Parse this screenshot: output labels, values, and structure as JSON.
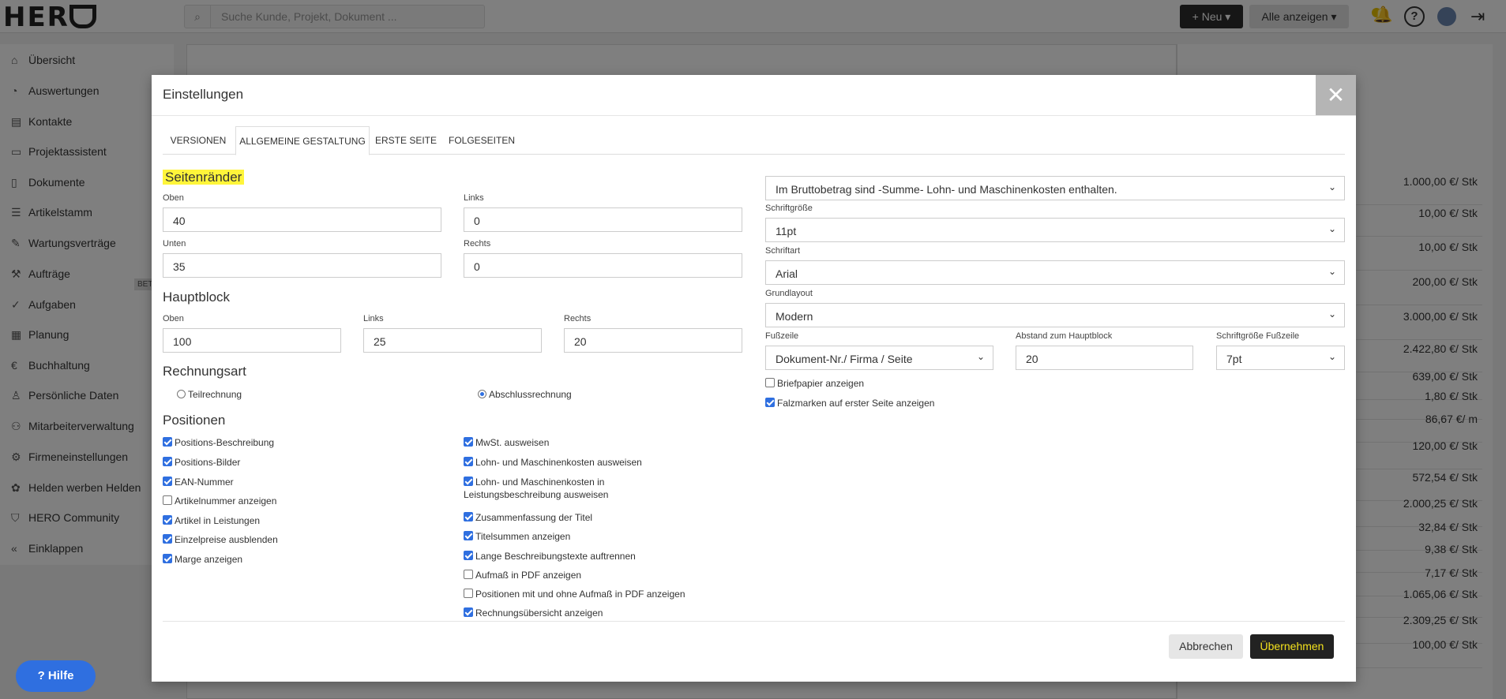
{
  "app": {
    "search_placeholder": "Suche Kunde, Projekt, Dokument ...",
    "new_label": "+ Neu",
    "filter_label": "Alle anzeigen",
    "help_icon_text": "?",
    "hilfe_label": "Hilfe"
  },
  "sidebar": {
    "items": [
      {
        "label": "Übersicht",
        "icon": "home-icon"
      },
      {
        "label": "Auswertungen",
        "icon": "pie-chart-icon"
      },
      {
        "label": "Kontakte",
        "icon": "contacts-icon"
      },
      {
        "label": "Projektassistent",
        "icon": "inbox-icon"
      },
      {
        "label": "Dokumente",
        "icon": "document-icon"
      },
      {
        "label": "Artikelstamm",
        "icon": "list-icon"
      },
      {
        "label": "Wartungsverträge",
        "icon": "wrench-icon"
      },
      {
        "label": "Aufträge",
        "icon": "hammer-icon"
      },
      {
        "label": "Aufgaben",
        "icon": "check-circle-icon"
      },
      {
        "label": "Planung",
        "icon": "calendar-icon"
      },
      {
        "label": "Buchhaltung",
        "icon": "euro-icon"
      },
      {
        "label": "Persönliche Daten",
        "icon": "user-icon"
      },
      {
        "label": "Mitarbeiterverwaltung",
        "icon": "users-icon"
      },
      {
        "label": "Firmeneinstellungen",
        "icon": "gear-icon"
      },
      {
        "label": "Helden werben Helden",
        "icon": "gift-icon"
      },
      {
        "label": "HERO Community",
        "icon": "hero-icon"
      },
      {
        "label": "Einklappen",
        "icon": "collapse-icon"
      }
    ],
    "beta_badge": "BET"
  },
  "right_panel": {
    "prices": [
      "1.000,00 €/ Stk",
      "10,00 €/ Stk",
      "10,00 €/ Stk",
      "200,00 €/ Stk",
      "3.000,00 €/ Stk",
      "2.422,80 €/ Stk",
      "639,00 €/ Stk",
      "1,80 €/ Stk",
      "86,67 €/ m",
      "120,00 €/ Stk",
      "572,54 €/ Stk",
      "2.000,25 €/ Stk",
      "32,84 €/ Stk",
      "9,38 €/ Stk",
      "7,17 €/ Stk",
      "1.065,06 €/ Stk",
      "2.309,25 €/ Stk",
      "100,00 €/ Stk"
    ]
  },
  "modal": {
    "title": "Einstellungen",
    "close_label": "✕",
    "tabs": [
      "VERSIONEN",
      "ALLGEMEINE GESTALTUNG",
      "ERSTE SEITE",
      "FOLGESEITEN"
    ],
    "seitenraender": {
      "title": "Seitenränder",
      "oben_label": "Oben",
      "oben_value": "40",
      "links_label": "Links",
      "links_value": "0",
      "unten_label": "Unten",
      "unten_value": "35",
      "rechts_label": "Rechts",
      "rechts_value": "0"
    },
    "hauptblock": {
      "title": "Hauptblock",
      "oben_label": "Oben",
      "oben_value": "100",
      "links_label": "Links",
      "links_value": "25",
      "rechts_label": "Rechts",
      "rechts_value": "20"
    },
    "rechnungsart": {
      "title": "Rechnungsart",
      "option1": "Teilrechnung",
      "option2": "Abschlussrechnung"
    },
    "positionen": {
      "title": "Positionen",
      "left": [
        {
          "label": "Positions-Beschreibung",
          "checked": true
        },
        {
          "label": "Positions-Bilder",
          "checked": true
        },
        {
          "label": "EAN-Nummer",
          "checked": true
        },
        {
          "label": "Artikelnummer anzeigen",
          "checked": false
        },
        {
          "label": "Artikel in Leistungen",
          "checked": true
        },
        {
          "label": "Einzelpreise ausblenden",
          "checked": true
        },
        {
          "label": "Marge anzeigen",
          "checked": true
        }
      ],
      "right": [
        {
          "label": "MwSt. ausweisen",
          "checked": true
        },
        {
          "label": "Lohn- und Maschinenkosten ausweisen",
          "checked": true
        },
        {
          "label": "Lohn- und Maschinenkosten in Leistungsbeschreibung ausweisen",
          "checked": true
        },
        {
          "label": "Zusammenfassung der Titel",
          "checked": true
        },
        {
          "label": "Titelsummen anzeigen",
          "checked": true
        },
        {
          "label": "Lange Beschreibungstexte auftrennen",
          "checked": true
        },
        {
          "label": "Aufmaß in PDF anzeigen",
          "checked": false
        },
        {
          "label": "Positionen mit und ohne Aufmaß in PDF anzeigen",
          "checked": false
        },
        {
          "label": "Rechnungsübersicht anzeigen",
          "checked": true
        }
      ]
    },
    "right_col": {
      "brutto_select": "Im Bruttobetrag sind -Summe- Lohn- und Maschinenkosten enthalten.",
      "schriftgroesse_label": "Schriftgröße",
      "schriftgroesse_value": "11pt",
      "schriftart_label": "Schriftart",
      "schriftart_value": "Arial",
      "grundlayout_label": "Grundlayout",
      "grundlayout_value": "Modern",
      "fusszeile_label": "Fußzeile",
      "fusszeile_value": "Dokument-Nr./ Firma / Seite",
      "abstand_label": "Abstand zum Hauptblock",
      "abstand_value": "20",
      "fuss_size_label": "Schriftgröße Fußzeile",
      "fuss_size_value": "7pt",
      "briefpapier_label": "Briefpapier anzeigen",
      "briefpapier_checked": false,
      "falzmarken_label": "Falzmarken auf erster Seite anzeigen",
      "falzmarken_checked": true
    },
    "cancel_label": "Abbrechen",
    "apply_label": "Übernehmen"
  }
}
